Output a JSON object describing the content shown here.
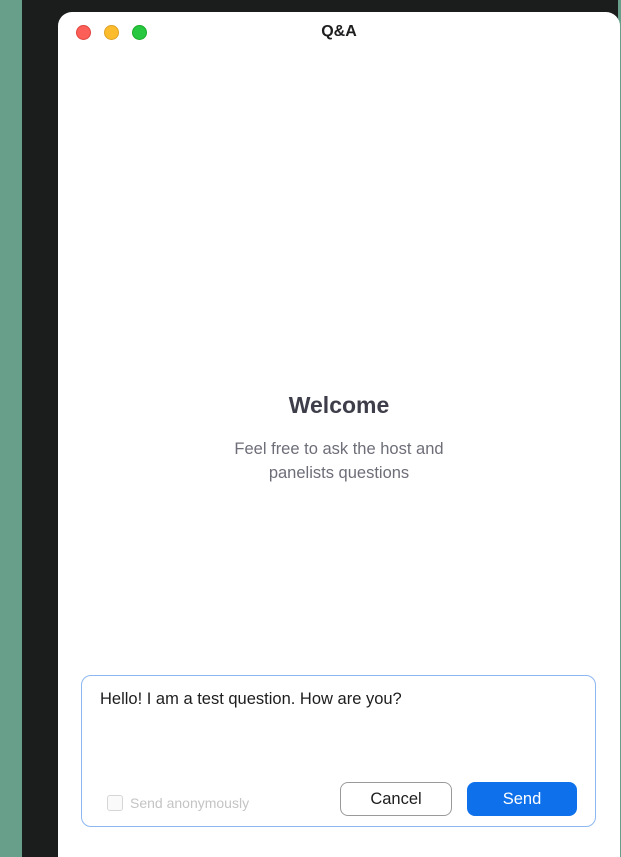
{
  "window": {
    "title": "Q&A"
  },
  "welcome": {
    "heading": "Welcome",
    "subtitle": "Feel free to ask the host and panelists questions"
  },
  "composer": {
    "question_value": "Hello! I am a test question. How are you?",
    "anonymous_label": "Send anonymously",
    "anonymous_checked": false,
    "cancel_label": "Cancel",
    "send_label": "Send"
  },
  "colors": {
    "background": "#679f8b",
    "accent": "#0e71eb",
    "composer_border": "#8db7f1",
    "traffic_close": "#fc5f57",
    "traffic_minimize": "#fdbc2e",
    "traffic_zoom": "#27c840"
  }
}
